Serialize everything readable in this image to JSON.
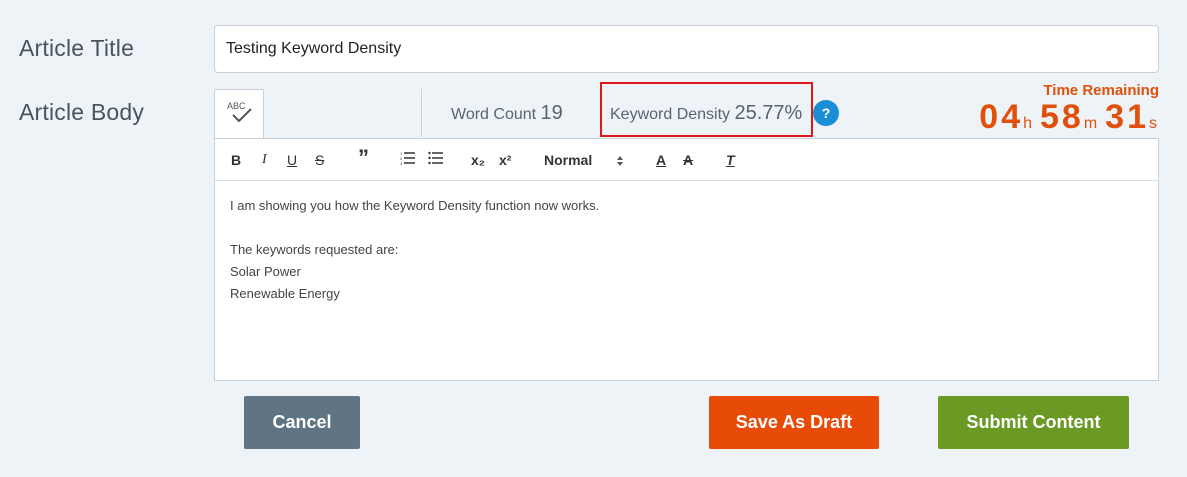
{
  "labels": {
    "article_title": "Article Title",
    "article_body": "Article Body"
  },
  "title_input": {
    "value": "Testing Keyword Density"
  },
  "spellcheck": {
    "label": "ABC",
    "icon": "spellcheck-icon"
  },
  "stats": {
    "word_count_label": "Word Count",
    "word_count_value": "19",
    "keyword_density_label": "Keyword Density",
    "keyword_density_value": "25.77%",
    "help_label": "?"
  },
  "timer": {
    "label": "Time Remaining",
    "hours": "04",
    "hours_unit": "h",
    "minutes": "58",
    "minutes_unit": "m",
    "seconds": "31",
    "seconds_unit": "s"
  },
  "toolbar": {
    "bold": "B",
    "italic": "I",
    "underline": "U",
    "strike": "S",
    "quote": "”",
    "ordered_list": "☰",
    "bullet_list": "☰",
    "subscript": "x₂",
    "superscript": "x²",
    "format_value": "Normal",
    "font_color": "A",
    "highlight": "A",
    "clear_format": "T"
  },
  "content": {
    "lines": [
      "I am showing you how the Keyword Density function now works.",
      "",
      "The keywords requested are:",
      "Solar Power",
      "Renewable Energy"
    ]
  },
  "buttons": {
    "cancel": "Cancel",
    "save_draft": "Save As Draft",
    "submit": "Submit Content"
  },
  "colors": {
    "accent": "#e0500b",
    "cancel": "#5f7584",
    "draft": "#e84a08",
    "submit": "#6a9a24",
    "help": "#1b8fd6",
    "highlight_border": "#e0161d"
  }
}
